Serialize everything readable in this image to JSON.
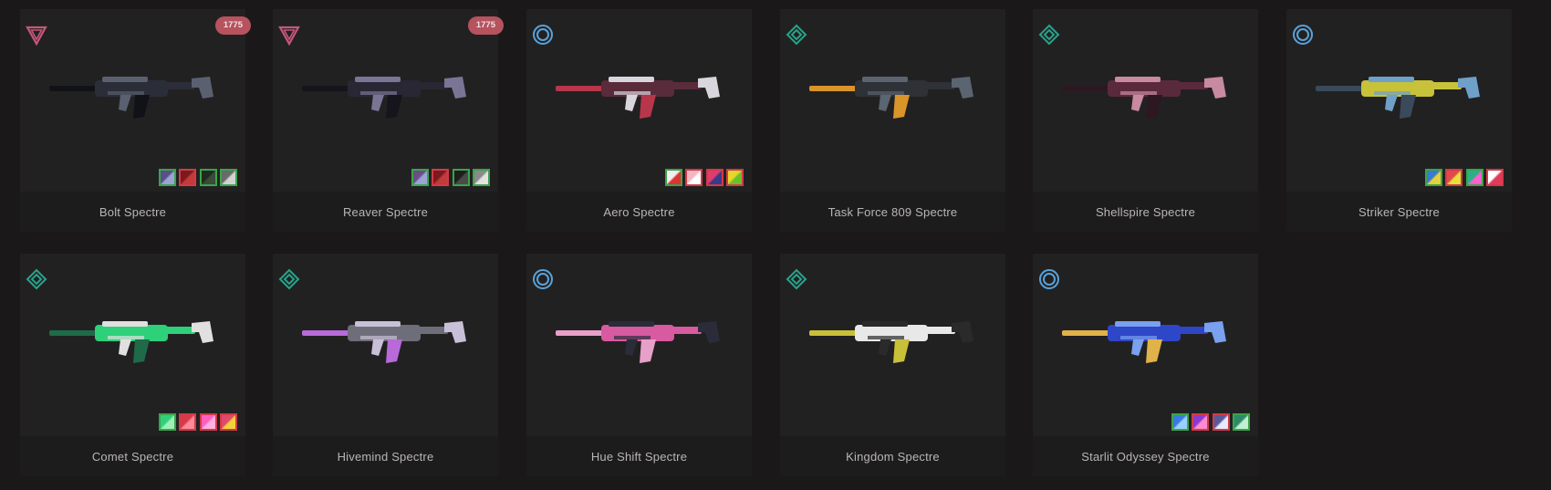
{
  "cards": [
    {
      "name": "Bolt Spectre",
      "tier": "premium",
      "tier_icon": "triangle-icon",
      "tier_color": "#c7577a",
      "price": "1775",
      "gun_colors": [
        "#2b2d38",
        "#5a6070",
        "#111218"
      ],
      "chromas": [
        {
          "c1": "#5a4f86",
          "c2": "#9aa3d6",
          "sel": false
        },
        {
          "c1": "#7a1a1f",
          "c2": "#c23a3a",
          "sel": true
        },
        {
          "c1": "#1f2a1f",
          "c2": "#3b4a3b",
          "sel": false
        },
        {
          "c1": "#6a6a6a",
          "c2": "#d2d2d2",
          "sel": false
        }
      ]
    },
    {
      "name": "Reaver Spectre",
      "tier": "premium",
      "tier_icon": "triangle-icon",
      "tier_color": "#c7577a",
      "price": "1775",
      "gun_colors": [
        "#2a2734",
        "#7b7595",
        "#16141c"
      ],
      "chromas": [
        {
          "c1": "#6a4f86",
          "c2": "#9aa3d6",
          "sel": false
        },
        {
          "c1": "#7a1a1f",
          "c2": "#c23a3a",
          "sel": true
        },
        {
          "c1": "#1e1e1e",
          "c2": "#4a4a4a",
          "sel": false
        },
        {
          "c1": "#8a8a8a",
          "c2": "#e2e2e2",
          "sel": false
        }
      ]
    },
    {
      "name": "Aero Spectre",
      "tier": "select",
      "tier_icon": "ring-icon",
      "tier_color": "#5aa2d8",
      "price": "",
      "gun_colors": [
        "#5a2b3a",
        "#d8d6dc",
        "#b7364a"
      ],
      "chromas": [
        {
          "c1": "#f0f0f0",
          "c2": "#d33",
          "sel": false
        },
        {
          "c1": "#f4b6c2",
          "c2": "#ffffff",
          "sel": true
        },
        {
          "c1": "#e23b6e",
          "c2": "#3a3a8a",
          "sel": true
        },
        {
          "c1": "#e8d62a",
          "c2": "#6bbf2a",
          "sel": true
        }
      ]
    },
    {
      "name": "Task Force 809 Spectre",
      "tier": "deluxe",
      "tier_icon": "diamond-icon",
      "tier_color": "#27a38a",
      "price": "",
      "gun_colors": [
        "#2e3136",
        "#5b6471",
        "#d9942a"
      ],
      "chromas": []
    },
    {
      "name": "Shellspire Spectre",
      "tier": "deluxe",
      "tier_icon": "diamond-icon",
      "tier_color": "#27a38a",
      "price": "",
      "gun_colors": [
        "#5a2a3c",
        "#c88aa0",
        "#2c1820"
      ],
      "chromas": []
    },
    {
      "name": "Striker Spectre",
      "tier": "select",
      "tier_icon": "ring-icon",
      "tier_color": "#5aa2d8",
      "price": "",
      "gun_colors": [
        "#c7c23a",
        "#6fa0c8",
        "#3a4a5a"
      ],
      "chromas": [
        {
          "c1": "#3a7ad0",
          "c2": "#e6d13a",
          "sel": false
        },
        {
          "c1": "#e04a4a",
          "c2": "#e6e03a",
          "sel": true
        },
        {
          "c1": "#2bb08a",
          "c2": "#ff5fd0",
          "sel": false
        },
        {
          "c1": "#ffffff",
          "c2": "#e03a5a",
          "sel": true
        }
      ]
    },
    {
      "name": "Comet Spectre",
      "tier": "deluxe",
      "tier_icon": "diamond-icon",
      "tier_color": "#27a38a",
      "price": "",
      "gun_colors": [
        "#2fd07a",
        "#e0e0e0",
        "#1f6a48"
      ],
      "chromas": [
        {
          "c1": "#2fd07a",
          "c2": "#9cf0b8",
          "sel": false
        },
        {
          "c1": "#d83a4a",
          "c2": "#ff8a9a",
          "sel": true
        },
        {
          "c1": "#ff5fbf",
          "c2": "#ffb0e0",
          "sel": true
        },
        {
          "c1": "#e04a6a",
          "c2": "#f0d23a",
          "sel": true
        }
      ]
    },
    {
      "name": "Hivemind Spectre",
      "tier": "deluxe",
      "tier_icon": "diamond-icon",
      "tier_color": "#27a38a",
      "price": "",
      "gun_colors": [
        "#6e6e7a",
        "#c8c0d8",
        "#b76ad8"
      ],
      "chromas": []
    },
    {
      "name": "Hue Shift Spectre",
      "tier": "select",
      "tier_icon": "ring-icon",
      "tier_color": "#5aa2d8",
      "price": "",
      "gun_colors": [
        "#d85aa0",
        "#2a2c3a",
        "#e7a0c8"
      ],
      "chromas": []
    },
    {
      "name": "Kingdom Spectre",
      "tier": "deluxe",
      "tier_icon": "diamond-icon",
      "tier_color": "#27a38a",
      "price": "",
      "gun_colors": [
        "#e8e8e8",
        "#2a2a2a",
        "#c9c03a"
      ],
      "chromas": []
    },
    {
      "name": "Starlit Odyssey Spectre",
      "tier": "select",
      "tier_icon": "ring-icon",
      "tier_color": "#5aa2d8",
      "price": "",
      "gun_colors": [
        "#2e46c8",
        "#7aa0f0",
        "#e0b24a"
      ],
      "chromas": [
        {
          "c1": "#3a7ae0",
          "c2": "#9ad0ff",
          "sel": false
        },
        {
          "c1": "#8a3ad0",
          "c2": "#ff8ad0",
          "sel": true
        },
        {
          "c1": "#5a5a9a",
          "c2": "#e8e8ff",
          "sel": true
        },
        {
          "c1": "#2a8a6a",
          "c2": "#c0f0d0",
          "sel": false
        }
      ]
    }
  ]
}
